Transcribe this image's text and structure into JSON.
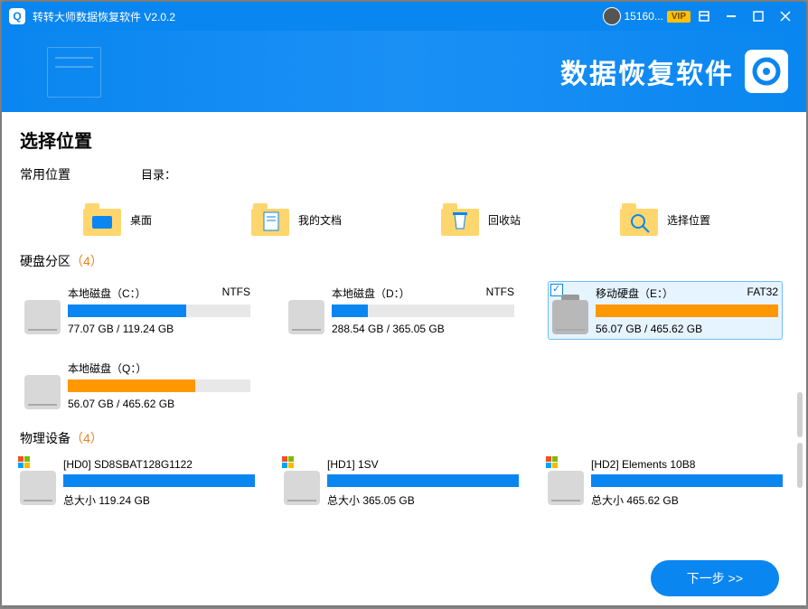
{
  "title": "转转大师数据恢复软件 V2.0.2",
  "user": {
    "name": "15160...",
    "badge": "VIP"
  },
  "banner": {
    "title": "数据恢复软件"
  },
  "main": {
    "heading": "选择位置",
    "common_label": "常用位置",
    "dir_label": "目录：",
    "common": [
      {
        "label": "桌面",
        "name": "desktop"
      },
      {
        "label": "我的文档",
        "name": "documents"
      },
      {
        "label": "回收站",
        "name": "recycle-bin"
      },
      {
        "label": "选择位置",
        "name": "choose-location"
      }
    ],
    "partition_label": "硬盘分区",
    "partition_count": "（4）",
    "partitions": [
      {
        "name": "本地磁盘（C：）",
        "fs": "NTFS",
        "size": "77.07 GB / 119.24 GB",
        "fill": 65,
        "color": "blue",
        "selected": false,
        "ext": false
      },
      {
        "name": "本地磁盘（D：）",
        "fs": "NTFS",
        "size": "288.54 GB / 365.05 GB",
        "fill": 20,
        "color": "blue",
        "selected": false,
        "ext": false
      },
      {
        "name": "移动硬盘（E：）",
        "fs": "FAT32",
        "size": "56.07 GB / 465.62 GB",
        "fill": 100,
        "color": "orange",
        "selected": true,
        "ext": true
      },
      {
        "name": "本地磁盘（Q：）",
        "fs": "",
        "size": "56.07 GB / 465.62 GB",
        "fill": 70,
        "color": "orange",
        "selected": false,
        "ext": false
      }
    ],
    "physical_label": "物理设备",
    "physical_count": "（4）",
    "physical": [
      {
        "name": "[HD0] SD8SBAT128G1122",
        "size": "总大小 119.24 GB",
        "fill": 100
      },
      {
        "name": "[HD1] 1SV",
        "size": "总大小 365.05 GB",
        "fill": 100
      },
      {
        "name": "[HD2] Elements 10B8",
        "size": "总大小 465.62 GB",
        "fill": 100
      }
    ]
  },
  "footer": {
    "next": "下一步 >>"
  }
}
